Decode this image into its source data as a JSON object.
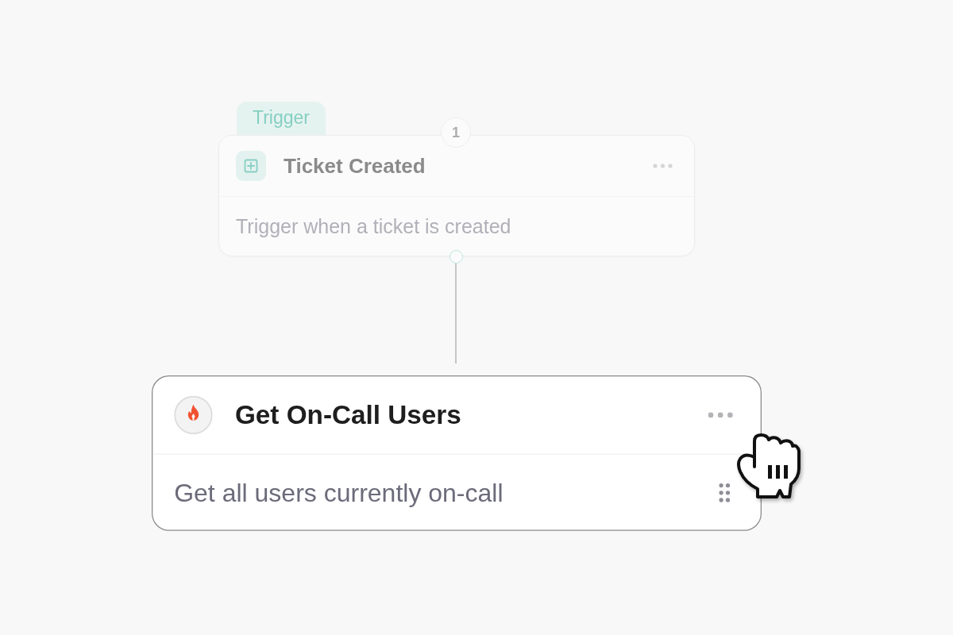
{
  "canvas": {
    "nodes": [
      {
        "kind": "trigger",
        "tag": "Trigger",
        "step": "1",
        "title": "Ticket Created",
        "description": "Trigger when a ticket is created",
        "selected": false
      },
      {
        "kind": "action",
        "title": "Get On-Call Users",
        "description": "Get all users currently on-call",
        "selected": true
      }
    ]
  }
}
